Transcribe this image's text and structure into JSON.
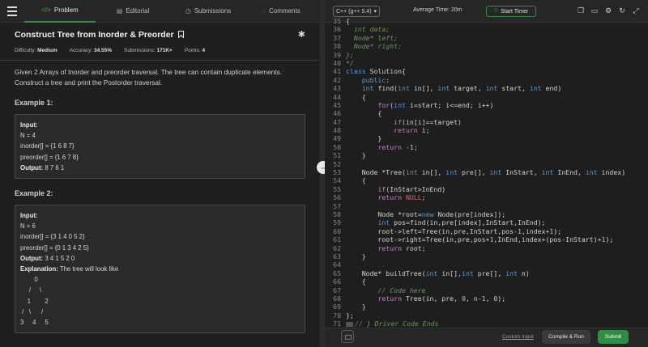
{
  "tabs": [
    {
      "label": "Problem",
      "icon": "code-icon"
    },
    {
      "label": "Editorial",
      "icon": "document-icon"
    },
    {
      "label": "Submissions",
      "icon": "clock-icon"
    },
    {
      "label": "Comments",
      "icon": "comment-icon"
    }
  ],
  "problem": {
    "title": "Construct Tree from Inorder & Preorder",
    "difficulty_label": "Difficulty:",
    "difficulty": "Medium",
    "accuracy_label": "Accuracy:",
    "accuracy": "34.55%",
    "submissions_label": "Submissions:",
    "submissions": "171K+",
    "points_label": "Points:",
    "points": "4",
    "description": "Given 2 Arrays of Inorder and preorder traversal. The tree can contain duplicate elements. Construct a tree and print the Postorder traversal."
  },
  "examples": [
    {
      "title": "Example 1:",
      "input_label": "Input:",
      "lines": [
        "N = 4",
        "inorder[] = {1 6 8 7}",
        "preorder[] = {1 6 7 8}"
      ],
      "output_label": "Output:",
      "output": "8 7 6 1"
    },
    {
      "title": "Example 2:",
      "input_label": "Input:",
      "lines": [
        "N = 6",
        "inorder[] = {3 1 4 0 5 2}",
        "preorder[] = {0 1 3 4 2 5}"
      ],
      "output_label": "Output:",
      "output": "3 4 1 5 2 0",
      "explanation_label": "Explanation:",
      "explanation": "The tree will look like",
      "tree": [
        "        0",
        "     /     \\",
        "    1        2",
        " /   \\      /",
        "3     4     5"
      ]
    }
  ],
  "editor": {
    "language": "C++ (g++ 5.4)",
    "average_time": "Average Time: 20m",
    "timer_label": "Start Timer",
    "line_numbers": [
      "35",
      "36",
      "37",
      "38",
      "39",
      "40",
      "41",
      "42",
      "43",
      "44",
      "45",
      "46",
      "47",
      "48",
      "49",
      "50",
      "51",
      "52",
      "53",
      "54",
      "55",
      "56",
      "57",
      "58",
      "59",
      "60",
      "61",
      "62",
      "63",
      "64",
      "65",
      "66",
      "67",
      "68",
      "69",
      "70",
      "71"
    ]
  },
  "actions": {
    "custom_input": "Custom Input",
    "compile_run": "Compile & Run",
    "submit": "Submit"
  },
  "colors": {
    "accent": "#2f8d46",
    "background": "#1e1e1e",
    "keyword": "#569cd6",
    "number": "#b5cea8",
    "comment": "#6a9955"
  }
}
